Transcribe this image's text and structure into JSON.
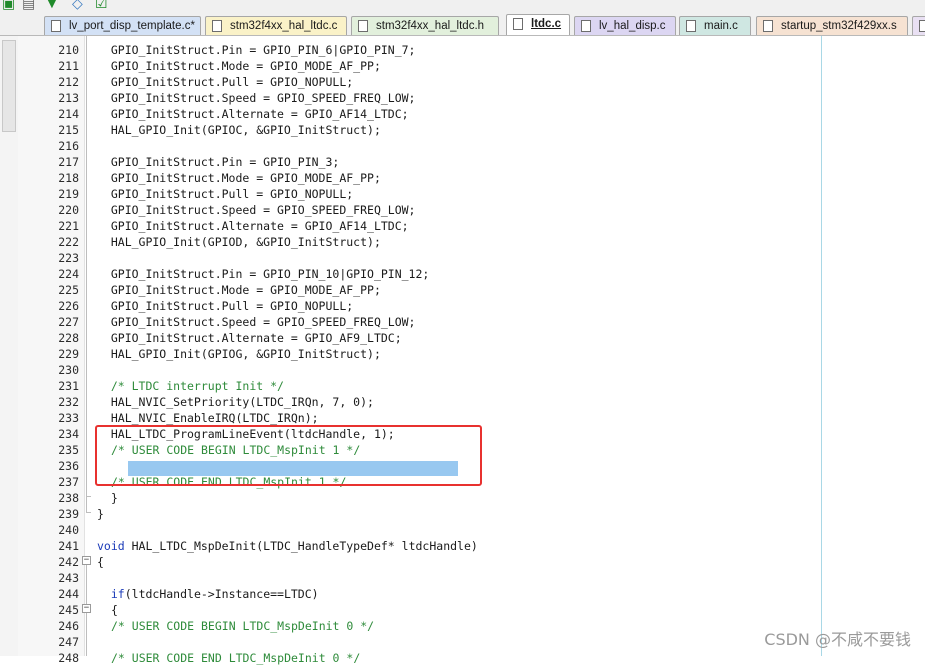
{
  "tabs": [
    {
      "label": "lv_port_disp_template.c*",
      "color": "#d3e1f5",
      "active": false
    },
    {
      "label": "stm32f4xx_hal_ltdc.c",
      "color": "#faf2c8",
      "active": false
    },
    {
      "label": "stm32f4xx_hal_ltdc.h",
      "color": "#e2f0dc",
      "active": false
    },
    {
      "label": "ltdc.c",
      "color": "#ffffff",
      "active": true
    },
    {
      "label": "lv_hal_disp.c",
      "color": "#dcd6f2",
      "active": false
    },
    {
      "label": "main.c",
      "color": "#cfe7e2",
      "active": false
    },
    {
      "label": "startup_stm32f429xx.s",
      "color": "#f6e2d2",
      "active": false
    }
  ],
  "colors": {
    "keyword": "#1b3bb8",
    "comment": "#2e8b3a",
    "highlight_box": "#e8312f",
    "selection": "#98c8f0"
  },
  "code_lines": [
    {
      "num": "210",
      "text": "  GPIO_InitStruct.Pin = GPIO_PIN_6|GPIO_PIN_7;"
    },
    {
      "num": "211",
      "text": "  GPIO_InitStruct.Mode = GPIO_MODE_AF_PP;"
    },
    {
      "num": "212",
      "text": "  GPIO_InitStruct.Pull = GPIO_NOPULL;"
    },
    {
      "num": "213",
      "text": "  GPIO_InitStruct.Speed = GPIO_SPEED_FREQ_LOW;"
    },
    {
      "num": "214",
      "text": "  GPIO_InitStruct.Alternate = GPIO_AF14_LTDC;"
    },
    {
      "num": "215",
      "text": "  HAL_GPIO_Init(GPIOC, &GPIO_InitStruct);"
    },
    {
      "num": "216",
      "text": ""
    },
    {
      "num": "217",
      "text": "  GPIO_InitStruct.Pin = GPIO_PIN_3;"
    },
    {
      "num": "218",
      "text": "  GPIO_InitStruct.Mode = GPIO_MODE_AF_PP;"
    },
    {
      "num": "219",
      "text": "  GPIO_InitStruct.Pull = GPIO_NOPULL;"
    },
    {
      "num": "220",
      "text": "  GPIO_InitStruct.Speed = GPIO_SPEED_FREQ_LOW;"
    },
    {
      "num": "221",
      "text": "  GPIO_InitStruct.Alternate = GPIO_AF14_LTDC;"
    },
    {
      "num": "222",
      "text": "  HAL_GPIO_Init(GPIOD, &GPIO_InitStruct);"
    },
    {
      "num": "223",
      "text": ""
    },
    {
      "num": "224",
      "text": "  GPIO_InitStruct.Pin = GPIO_PIN_10|GPIO_PIN_12;"
    },
    {
      "num": "225",
      "text": "  GPIO_InitStruct.Mode = GPIO_MODE_AF_PP;"
    },
    {
      "num": "226",
      "text": "  GPIO_InitStruct.Pull = GPIO_NOPULL;"
    },
    {
      "num": "227",
      "text": "  GPIO_InitStruct.Speed = GPIO_SPEED_FREQ_LOW;"
    },
    {
      "num": "228",
      "text": "  GPIO_InitStruct.Alternate = GPIO_AF9_LTDC;"
    },
    {
      "num": "229",
      "text": "  HAL_GPIO_Init(GPIOG, &GPIO_InitStruct);"
    },
    {
      "num": "230",
      "text": ""
    },
    {
      "num": "231",
      "text": "  /* LTDC interrupt Init */"
    },
    {
      "num": "232",
      "text": "  HAL_NVIC_SetPriority(LTDC_IRQn, 7, 0);"
    },
    {
      "num": "233",
      "text": "  HAL_NVIC_EnableIRQ(LTDC_IRQn);"
    },
    {
      "num": "234",
      "text": "  HAL_LTDC_ProgramLineEvent(ltdcHandle, 1);"
    },
    {
      "num": "235",
      "text": "/* USER CODE BEGIN LTDC_MspInit 1 */"
    },
    {
      "num": "236",
      "text": ""
    },
    {
      "num": "237",
      "text": "/* USER CODE END LTDC_MspInit 1 */"
    },
    {
      "num": "238",
      "text": "}"
    },
    {
      "num": "239",
      "text": "}"
    },
    {
      "num": "240",
      "text": ""
    },
    {
      "num": "241",
      "text": "void HAL_LTDC_MspDeInit(LTDC_HandleTypeDef* ltdcHandle)"
    },
    {
      "num": "242",
      "text": "{"
    },
    {
      "num": "243",
      "text": ""
    },
    {
      "num": "244",
      "text": "if(ltdcHandle->Instance==LTDC)"
    },
    {
      "num": "245",
      "text": "{"
    },
    {
      "num": "246",
      "text": "/* USER CODE BEGIN LTDC_MspDeInit 0 */"
    },
    {
      "num": "247",
      "text": ""
    },
    {
      "num": "248",
      "text": "/* USER CODE END LTDC_MspDeInit 0 */"
    }
  ],
  "watermark": "CSDN @不咸不要钱"
}
